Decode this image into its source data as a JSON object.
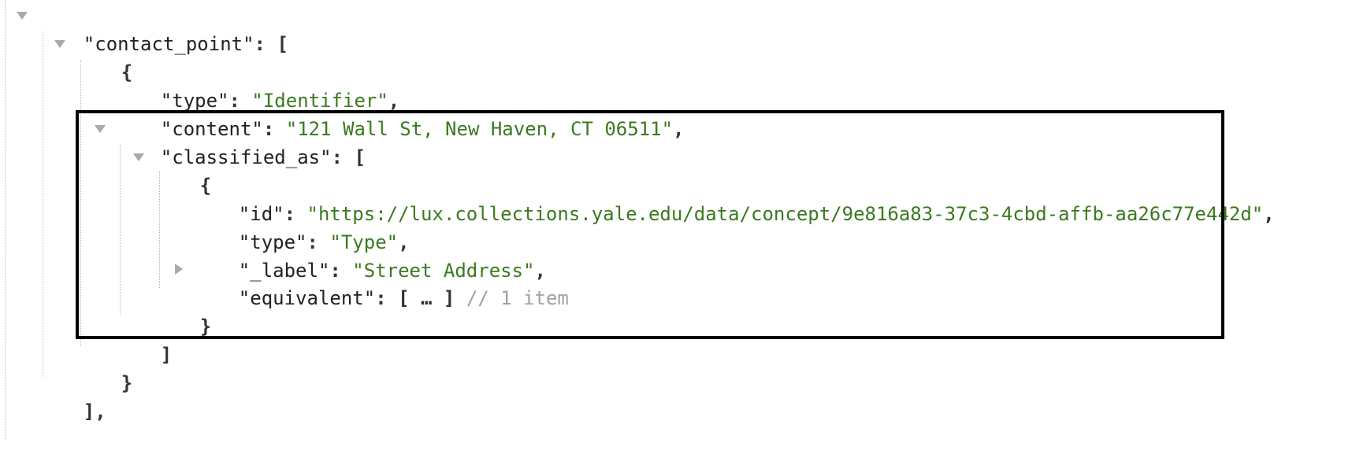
{
  "json_tree": {
    "contact_point": {
      "key": "\"contact_point\"",
      "sep": ": ",
      "open": "[",
      "close": "],"
    },
    "item": {
      "open": "{",
      "close": "}",
      "type": {
        "key": "\"type\"",
        "sep": ": ",
        "value": "\"Identifier\"",
        "trail": ","
      },
      "content": {
        "key": "\"content\"",
        "sep": ": ",
        "value": "\"121 Wall St, New Haven, CT 06511\"",
        "trail": ","
      }
    },
    "classified_as": {
      "key": "\"classified_as\"",
      "sep": ": ",
      "open": "[",
      "close": "]",
      "item": {
        "open": "{",
        "close": "}",
        "id": {
          "key": "\"id\"",
          "sep": ": ",
          "value": "\"https://lux.collections.yale.edu/data/concept/9e816a83-37c3-4cbd-affb-aa26c77e442d\"",
          "trail": ","
        },
        "type": {
          "key": "\"type\"",
          "sep": ": ",
          "value": "\"Type\"",
          "trail": ","
        },
        "label": {
          "key": "\"_label\"",
          "sep": ": ",
          "value": "\"Street Address\"",
          "trail": ","
        },
        "equivalent": {
          "key": "\"equivalent\"",
          "sep": ": ",
          "open": "[",
          "ellipsis": "…",
          "close": "]",
          "comment": "// 1 item"
        }
      }
    }
  },
  "colors": {
    "string": "#3a7a1f",
    "key": "#222222",
    "comment": "#a0a0a0",
    "toggle": "#a9a9a9",
    "highlight_border": "#000000"
  },
  "icons": {
    "expanded": "triangle-down-icon",
    "collapsed": "triangle-right-icon"
  }
}
